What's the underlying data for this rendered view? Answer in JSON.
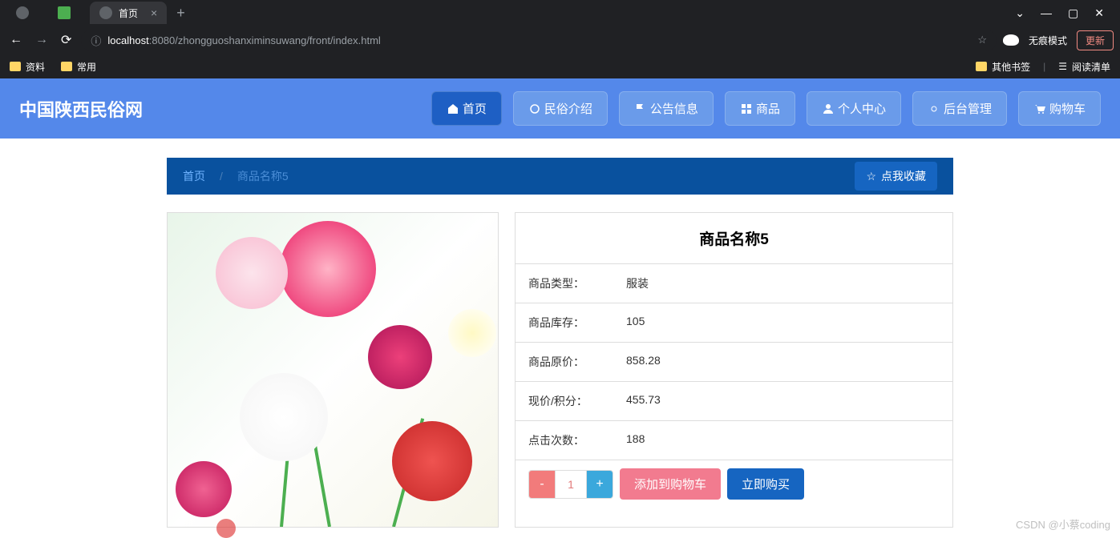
{
  "browser": {
    "tab_title": "首页",
    "url_host": "localhost",
    "url_port_path": ":8080/zhongguoshanximinsuwang/front/index.html",
    "incognito_label": "无痕模式",
    "update_label": "更新"
  },
  "bookmarks": {
    "b1": "资料",
    "b2": "常用",
    "other": "其他书签",
    "reading": "阅读清单"
  },
  "site": {
    "title": "中国陕西民俗网",
    "nav": {
      "home": "首页",
      "intro": "民俗介绍",
      "notice": "公告信息",
      "goods": "商品",
      "user": "个人中心",
      "admin": "后台管理",
      "cart": "购物车"
    }
  },
  "breadcrumb": {
    "home": "首页",
    "sep": "/",
    "current": "商品名称5",
    "favorite": "点我收藏"
  },
  "product": {
    "title": "商品名称5",
    "rows": {
      "type_l": "商品类型：",
      "type_v": "服装",
      "stock_l": "商品库存：",
      "stock_v": "105",
      "orig_l": "商品原价：",
      "orig_v": "858.28",
      "now_l": "现价/积分：",
      "now_v": "455.73",
      "click_l": "点击次数：",
      "click_v": "188"
    },
    "qty": "1",
    "minus": "-",
    "plus": "+",
    "add_cart": "添加到购物车",
    "buy_now": "立即购买"
  },
  "watermark": "CSDN @小蔡coding"
}
